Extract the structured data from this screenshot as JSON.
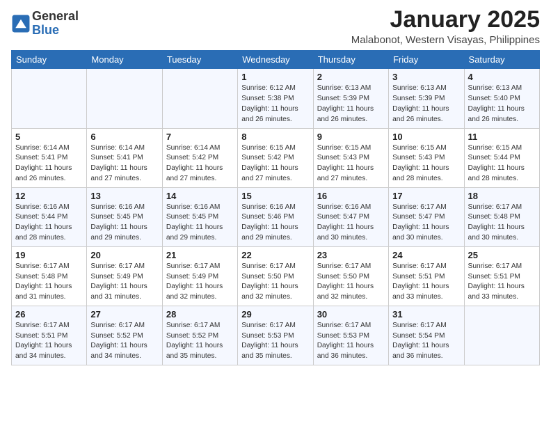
{
  "logo": {
    "general": "General",
    "blue": "Blue"
  },
  "title": "January 2025",
  "subtitle": "Malabonot, Western Visayas, Philippines",
  "weekdays": [
    "Sunday",
    "Monday",
    "Tuesday",
    "Wednesday",
    "Thursday",
    "Friday",
    "Saturday"
  ],
  "weeks": [
    [
      {
        "day": "",
        "info": ""
      },
      {
        "day": "",
        "info": ""
      },
      {
        "day": "",
        "info": ""
      },
      {
        "day": "1",
        "sunrise": "6:12 AM",
        "sunset": "5:38 PM",
        "daylight": "11 hours and 26 minutes."
      },
      {
        "day": "2",
        "sunrise": "6:13 AM",
        "sunset": "5:39 PM",
        "daylight": "11 hours and 26 minutes."
      },
      {
        "day": "3",
        "sunrise": "6:13 AM",
        "sunset": "5:39 PM",
        "daylight": "11 hours and 26 minutes."
      },
      {
        "day": "4",
        "sunrise": "6:13 AM",
        "sunset": "5:40 PM",
        "daylight": "11 hours and 26 minutes."
      }
    ],
    [
      {
        "day": "5",
        "sunrise": "6:14 AM",
        "sunset": "5:41 PM",
        "daylight": "11 hours and 26 minutes."
      },
      {
        "day": "6",
        "sunrise": "6:14 AM",
        "sunset": "5:41 PM",
        "daylight": "11 hours and 27 minutes."
      },
      {
        "day": "7",
        "sunrise": "6:14 AM",
        "sunset": "5:42 PM",
        "daylight": "11 hours and 27 minutes."
      },
      {
        "day": "8",
        "sunrise": "6:15 AM",
        "sunset": "5:42 PM",
        "daylight": "11 hours and 27 minutes."
      },
      {
        "day": "9",
        "sunrise": "6:15 AM",
        "sunset": "5:43 PM",
        "daylight": "11 hours and 27 minutes."
      },
      {
        "day": "10",
        "sunrise": "6:15 AM",
        "sunset": "5:43 PM",
        "daylight": "11 hours and 28 minutes."
      },
      {
        "day": "11",
        "sunrise": "6:15 AM",
        "sunset": "5:44 PM",
        "daylight": "11 hours and 28 minutes."
      }
    ],
    [
      {
        "day": "12",
        "sunrise": "6:16 AM",
        "sunset": "5:44 PM",
        "daylight": "11 hours and 28 minutes."
      },
      {
        "day": "13",
        "sunrise": "6:16 AM",
        "sunset": "5:45 PM",
        "daylight": "11 hours and 29 minutes."
      },
      {
        "day": "14",
        "sunrise": "6:16 AM",
        "sunset": "5:45 PM",
        "daylight": "11 hours and 29 minutes."
      },
      {
        "day": "15",
        "sunrise": "6:16 AM",
        "sunset": "5:46 PM",
        "daylight": "11 hours and 29 minutes."
      },
      {
        "day": "16",
        "sunrise": "6:16 AM",
        "sunset": "5:47 PM",
        "daylight": "11 hours and 30 minutes."
      },
      {
        "day": "17",
        "sunrise": "6:17 AM",
        "sunset": "5:47 PM",
        "daylight": "11 hours and 30 minutes."
      },
      {
        "day": "18",
        "sunrise": "6:17 AM",
        "sunset": "5:48 PM",
        "daylight": "11 hours and 30 minutes."
      }
    ],
    [
      {
        "day": "19",
        "sunrise": "6:17 AM",
        "sunset": "5:48 PM",
        "daylight": "11 hours and 31 minutes."
      },
      {
        "day": "20",
        "sunrise": "6:17 AM",
        "sunset": "5:49 PM",
        "daylight": "11 hours and 31 minutes."
      },
      {
        "day": "21",
        "sunrise": "6:17 AM",
        "sunset": "5:49 PM",
        "daylight": "11 hours and 32 minutes."
      },
      {
        "day": "22",
        "sunrise": "6:17 AM",
        "sunset": "5:50 PM",
        "daylight": "11 hours and 32 minutes."
      },
      {
        "day": "23",
        "sunrise": "6:17 AM",
        "sunset": "5:50 PM",
        "daylight": "11 hours and 32 minutes."
      },
      {
        "day": "24",
        "sunrise": "6:17 AM",
        "sunset": "5:51 PM",
        "daylight": "11 hours and 33 minutes."
      },
      {
        "day": "25",
        "sunrise": "6:17 AM",
        "sunset": "5:51 PM",
        "daylight": "11 hours and 33 minutes."
      }
    ],
    [
      {
        "day": "26",
        "sunrise": "6:17 AM",
        "sunset": "5:51 PM",
        "daylight": "11 hours and 34 minutes."
      },
      {
        "day": "27",
        "sunrise": "6:17 AM",
        "sunset": "5:52 PM",
        "daylight": "11 hours and 34 minutes."
      },
      {
        "day": "28",
        "sunrise": "6:17 AM",
        "sunset": "5:52 PM",
        "daylight": "11 hours and 35 minutes."
      },
      {
        "day": "29",
        "sunrise": "6:17 AM",
        "sunset": "5:53 PM",
        "daylight": "11 hours and 35 minutes."
      },
      {
        "day": "30",
        "sunrise": "6:17 AM",
        "sunset": "5:53 PM",
        "daylight": "11 hours and 36 minutes."
      },
      {
        "day": "31",
        "sunrise": "6:17 AM",
        "sunset": "5:54 PM",
        "daylight": "11 hours and 36 minutes."
      },
      {
        "day": "",
        "info": ""
      }
    ]
  ],
  "labels": {
    "sunrise_prefix": "Sunrise: ",
    "sunset_prefix": "Sunset: ",
    "daylight_prefix": "Daylight: "
  }
}
